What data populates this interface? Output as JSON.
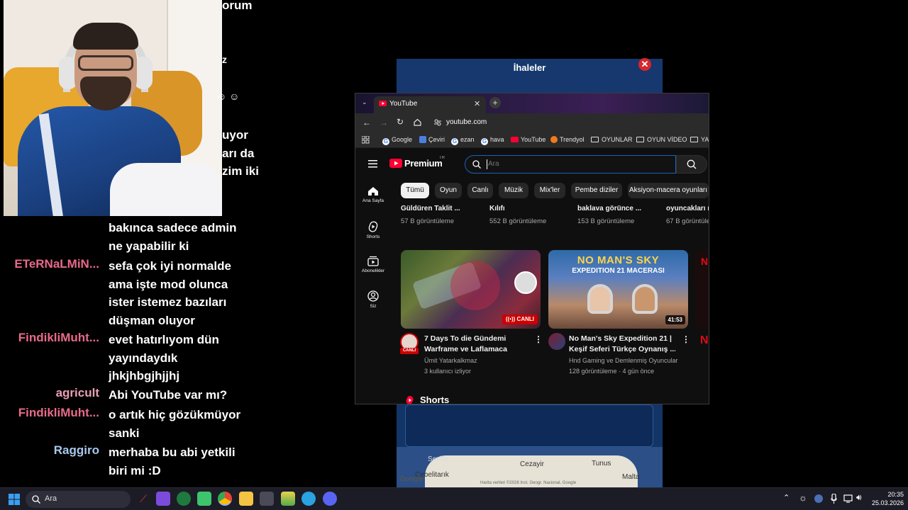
{
  "chat": {
    "top_fragments": [
      "orum",
      "z",
      "☺ ☺",
      "uyor",
      "arı da",
      "zim iki"
    ],
    "messages": [
      {
        "user": "",
        "lines": [
          "bakınca sadece admin",
          "ne yapabilir ki"
        ],
        "color": "#ffffff"
      },
      {
        "user": "ETeRNaLMiN...",
        "lines": [
          "sefa çok iyi normalde",
          "ama işte mod olunca",
          "ister istemez bazıları",
          "düşman oluyor"
        ],
        "color": "#e96a8a"
      },
      {
        "user": "FindikliMuht...",
        "lines": [
          "evet hatırlıyom dün",
          "yayındaydık",
          "jhkjhbgjhjjhj"
        ],
        "color": "#e96a8a"
      },
      {
        "user": "agricult",
        "lines": [
          "Abi YouTube var mı?"
        ],
        "color": "#e9a0b4"
      },
      {
        "user": "FindikliMuht...",
        "lines": [
          "o artık hiç gözükmüyor",
          "sanki"
        ],
        "color": "#e96a8a"
      },
      {
        "user": "Raggiro",
        "lines": [
          "merhaba bu abi yetkili",
          "biri mi :D"
        ],
        "color": "#a8c8ec"
      }
    ]
  },
  "game": {
    "title": "İhaleler",
    "close": "✕",
    "map_labels": [
      "Sevilla",
      "Cezayir",
      "Tunus",
      "Cebelitarık",
      "Malta",
      "Google"
    ],
    "map_footer": "Harita verileri ©2026 Inst. Geogr. Nacional, Google"
  },
  "browser": {
    "tab_title": "YouTube",
    "url": "youtube.com",
    "bookmarks": [
      "Google",
      "Çeviri",
      "ezan",
      "hava",
      "YouTube",
      "Trendyol",
      "OYUNLAR",
      "OYUN VİDEO",
      "YA"
    ],
    "youtube": {
      "logo": "Premium",
      "logo_region": "TR",
      "search_placeholder": "Ara",
      "sidebar": [
        "Ana Sayfa",
        "Shorts",
        "Abonelikler",
        "Siz"
      ],
      "chips": [
        "Tümü",
        "Oyun",
        "Canlı",
        "Müzik",
        "Mix'ler",
        "Pembe diziler",
        "Aksiyon-macera oyunları"
      ],
      "prev_row": [
        {
          "title": "Güldüren Taklit ...",
          "views": "57 B görüntüleme"
        },
        {
          "title": "Kılıfı",
          "views": "552 B görüntüleme"
        },
        {
          "title": "baklava görünce ...",
          "views": "153 B görüntüleme"
        },
        {
          "title": "oyuncakları r",
          "views": "67 B görüntüleme"
        }
      ],
      "videos": [
        {
          "title1": "7 Days To die Gündemi",
          "title2": "Warframe ve Laflamaca",
          "channel": "Ümit Yatarkalkmaz",
          "meta": "3 kullanıcı izliyor",
          "badge": "CANLI",
          "avatar_badge": "CANLI"
        },
        {
          "title1": "No Man's Sky Expedition 21 |",
          "title2": "Keşif Seferi Türkçe Oynanış ...",
          "channel": "Hnd Gaming ve Demlenmiş Oyuncular",
          "meta": "128 görüntüleme · 4 gün önce",
          "duration": "41:53",
          "thumb_line1": "NO MAN'S SKY",
          "thumb_line2": "EXPEDITION 21 MACERASI"
        }
      ],
      "shorts_label": "Shorts"
    }
  },
  "taskbar": {
    "search": "Ara",
    "time": "20:35",
    "date": "25.03.2026"
  }
}
